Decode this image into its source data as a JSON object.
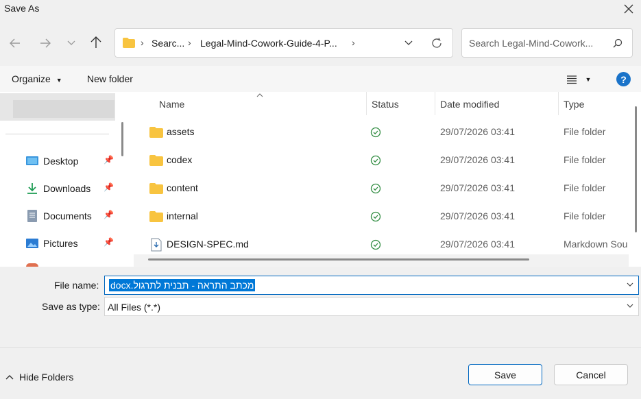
{
  "window": {
    "title": "Save As",
    "close_icon": "close-icon"
  },
  "nav": {
    "back_icon": "arrow-left-icon",
    "forward_icon": "arrow-right-icon",
    "recent_icon": "chevron-down-icon",
    "up_icon": "arrow-up-icon",
    "breadcrumb": [
      "Searc...",
      "Legal-Mind-Cowork-Guide-4-P..."
    ],
    "search_placeholder": "Search Legal-Mind-Cowork..."
  },
  "commands": {
    "organize": "Organize",
    "new_folder": "New folder"
  },
  "sidebar": {
    "items": [
      {
        "label": "Desktop",
        "icon": "desktop-icon"
      },
      {
        "label": "Downloads",
        "icon": "download-icon"
      },
      {
        "label": "Documents",
        "icon": "document-icon"
      },
      {
        "label": "Pictures",
        "icon": "picture-icon"
      }
    ]
  },
  "columns": {
    "name": "Name",
    "status": "Status",
    "date": "Date modified",
    "type": "Type"
  },
  "files": [
    {
      "name": "assets",
      "date": "29/07/2026 03:41",
      "type": "File folder",
      "kind": "folder"
    },
    {
      "name": "codex",
      "date": "29/07/2026 03:41",
      "type": "File folder",
      "kind": "folder"
    },
    {
      "name": "content",
      "date": "29/07/2026 03:41",
      "type": "File folder",
      "kind": "folder"
    },
    {
      "name": "internal",
      "date": "29/07/2026 03:41",
      "type": "File folder",
      "kind": "folder"
    },
    {
      "name": "DESIGN-SPEC.md",
      "date": "29/07/2026 03:41",
      "type": "Markdown Sou",
      "kind": "file"
    }
  ],
  "form": {
    "filename_label": "File name:",
    "filename_value": "מכתב התראה - תבנית לתרגול.docx",
    "savetype_label": "Save as type:",
    "savetype_value": "All Files (*.*)"
  },
  "footer": {
    "hide_folders": "Hide Folders",
    "save": "Save",
    "cancel": "Cancel"
  },
  "colors": {
    "accent": "#0078d7",
    "folder": "#f8c440",
    "status_ok": "#2e8b3f"
  }
}
